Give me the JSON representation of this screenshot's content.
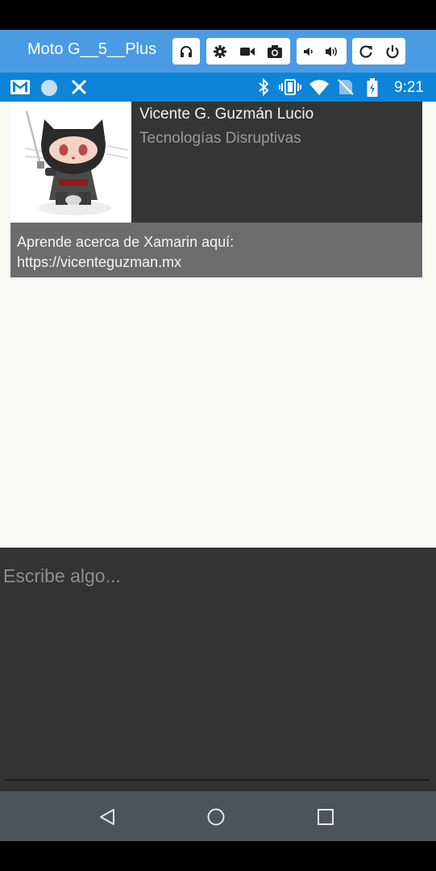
{
  "emulator": {
    "device_name": "Moto G__5__Plus",
    "buttons": [
      {
        "icon": "headset-icon"
      },
      {
        "icon": "settings-icon"
      },
      {
        "icon": "video-icon"
      },
      {
        "icon": "camera-icon"
      },
      {
        "icon": "volume-down-icon"
      },
      {
        "icon": "volume-up-icon"
      },
      {
        "icon": "rotate-icon"
      },
      {
        "icon": "power-icon"
      }
    ]
  },
  "status_bar": {
    "time": "9:21",
    "left_icons": [
      "gmail-icon",
      "circle-notification-icon",
      "xamarin-icon"
    ],
    "right_icons": [
      "bluetooth-icon",
      "vibrate-icon",
      "wifi-icon",
      "no-sim-icon",
      "battery-icon"
    ]
  },
  "card": {
    "name": "Vicente G. Guzmán Lucio",
    "company": "Tecnologías Disruptivas",
    "description": "Aprende acerca de Xamarin aquí:\nhttps://vicenteguzman.mx",
    "avatar_icon": "ninja-octocat-avatar"
  },
  "editor": {
    "placeholder": "Escribe algo...",
    "value": ""
  },
  "nav_bar": {
    "buttons": [
      "back-icon",
      "home-icon",
      "recents-icon"
    ]
  },
  "colors": {
    "emulator_bar": "#4b9be2",
    "status_bar": "#0d84d8",
    "card_top": "#353535",
    "card_bottom": "#6c6c6c",
    "editor_bg": "#333334",
    "nav_bar": "#4d5358",
    "content_bg": "#f8f8f4"
  }
}
